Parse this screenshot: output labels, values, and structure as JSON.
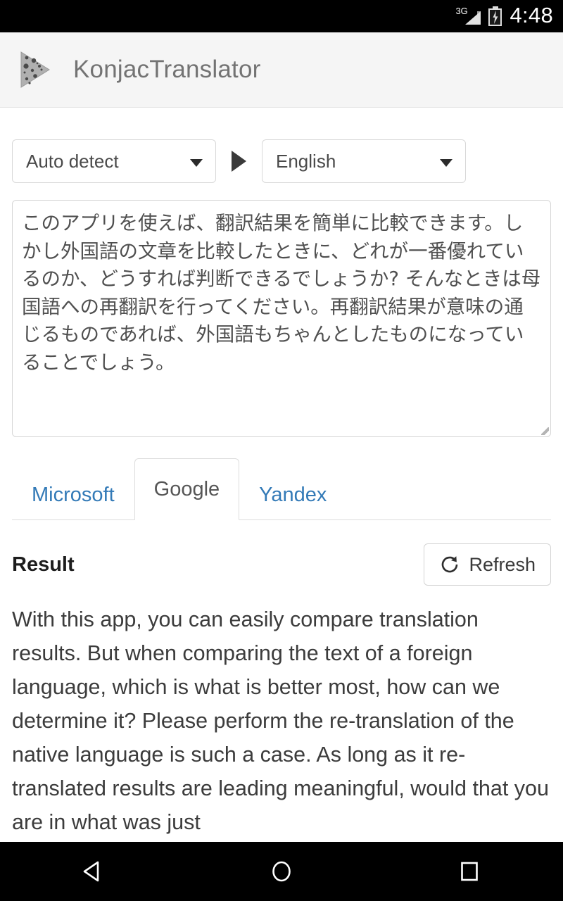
{
  "status_bar": {
    "network_label": "3G",
    "time": "4:48",
    "signal_icon": "signal-bars-icon",
    "battery_icon": "battery-charging-icon"
  },
  "action_bar": {
    "app_icon": "konjac-play-triangle-icon",
    "title": "KonjacTranslator"
  },
  "language_selector": {
    "source": {
      "value": "Auto detect",
      "caret_icon": "chevron-down-icon"
    },
    "arrow_icon": "arrow-right-triangle-icon",
    "target": {
      "value": "English",
      "caret_icon": "chevron-down-icon"
    }
  },
  "source_text": {
    "value": "このアプリを使えば、翻訳結果を簡単に比較できます。しかし外国語の文章を比較したときに、どれが一番優れているのか、どうすれば判断できるでしょうか? そんなときは母国語への再翻訳を行ってください。再翻訳結果が意味の通じるものであれば、外国語もちゃんとしたものになっていることでしょう。",
    "resize_grip_icon": "resize-grip-icon"
  },
  "tabs": [
    {
      "label": "Microsoft",
      "active": false
    },
    {
      "label": "Google",
      "active": true
    },
    {
      "label": "Yandex",
      "active": false
    }
  ],
  "result": {
    "title": "Result",
    "refresh_label": "Refresh",
    "refresh_icon": "refresh-circular-arrow-icon",
    "text": "With this app, you can easily compare translation results. But when comparing the text of a foreign language, which is what is better most, how can we determine it? Please perform the re-translation of the native language is such a case. As long as it re-translated results are leading meaningful, would that you are in what was just"
  },
  "nav_bar": {
    "back_icon": "back-triangle-icon",
    "home_icon": "home-circle-icon",
    "recents_icon": "recents-square-icon"
  },
  "colors": {
    "link_blue": "#337ab7",
    "action_bar_bg": "#f5f5f5",
    "status_bar_bg": "#000000",
    "text_dark": "#3c3c3c"
  }
}
